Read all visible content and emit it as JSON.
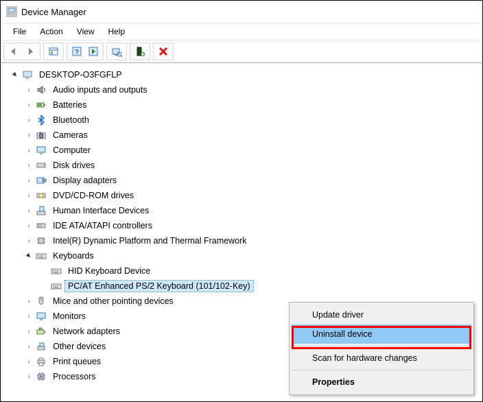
{
  "title": "Device Manager",
  "menu": {
    "file": "File",
    "action": "Action",
    "view": "View",
    "help": "Help"
  },
  "tree": {
    "root": "DESKTOP-O3FGFLP",
    "items": [
      {
        "label": "Audio inputs and outputs"
      },
      {
        "label": "Batteries"
      },
      {
        "label": "Bluetooth"
      },
      {
        "label": "Cameras"
      },
      {
        "label": "Computer"
      },
      {
        "label": "Disk drives"
      },
      {
        "label": "Display adapters"
      },
      {
        "label": "DVD/CD-ROM drives"
      },
      {
        "label": "Human Interface Devices"
      },
      {
        "label": "IDE ATA/ATAPI controllers"
      },
      {
        "label": "Intel(R) Dynamic Platform and Thermal Framework"
      },
      {
        "label": "Keyboards"
      },
      {
        "label": "Mice and other pointing devices"
      },
      {
        "label": "Monitors"
      },
      {
        "label": "Network adapters"
      },
      {
        "label": "Other devices"
      },
      {
        "label": "Print queues"
      },
      {
        "label": "Processors"
      }
    ],
    "keyboards_children": [
      {
        "label": "HID Keyboard Device"
      },
      {
        "label": "PC/AT Enhanced PS/2 Keyboard (101/102-Key)"
      }
    ]
  },
  "context": {
    "update": "Update driver",
    "uninstall": "Uninstall device",
    "scan": "Scan for hardware changes",
    "properties": "Properties"
  }
}
